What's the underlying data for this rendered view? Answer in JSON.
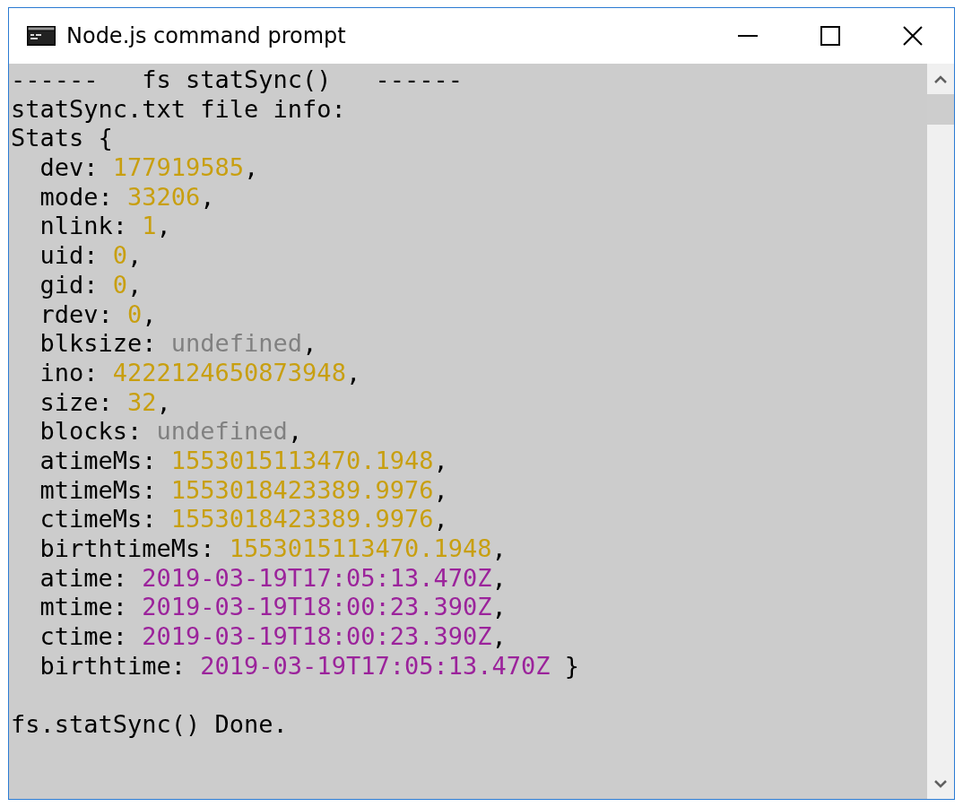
{
  "window": {
    "title": "Node.js command prompt"
  },
  "console": {
    "lines": [
      {
        "kind": "text",
        "segments": [
          {
            "kind": "plain",
            "text": "------   fs statSync()   ------"
          }
        ]
      },
      {
        "kind": "text",
        "segments": [
          {
            "kind": "plain",
            "text": "statSync.txt file info:"
          }
        ]
      },
      {
        "kind": "text",
        "segments": [
          {
            "kind": "plain",
            "text": "Stats {"
          }
        ]
      },
      {
        "kind": "text",
        "segments": [
          {
            "kind": "plain",
            "text": "  dev: "
          },
          {
            "kind": "number",
            "text": "177919585"
          },
          {
            "kind": "plain",
            "text": ","
          }
        ]
      },
      {
        "kind": "text",
        "segments": [
          {
            "kind": "plain",
            "text": "  mode: "
          },
          {
            "kind": "number",
            "text": "33206"
          },
          {
            "kind": "plain",
            "text": ","
          }
        ]
      },
      {
        "kind": "text",
        "segments": [
          {
            "kind": "plain",
            "text": "  nlink: "
          },
          {
            "kind": "number",
            "text": "1"
          },
          {
            "kind": "plain",
            "text": ","
          }
        ]
      },
      {
        "kind": "text",
        "segments": [
          {
            "kind": "plain",
            "text": "  uid: "
          },
          {
            "kind": "number",
            "text": "0"
          },
          {
            "kind": "plain",
            "text": ","
          }
        ]
      },
      {
        "kind": "text",
        "segments": [
          {
            "kind": "plain",
            "text": "  gid: "
          },
          {
            "kind": "number",
            "text": "0"
          },
          {
            "kind": "plain",
            "text": ","
          }
        ]
      },
      {
        "kind": "text",
        "segments": [
          {
            "kind": "plain",
            "text": "  rdev: "
          },
          {
            "kind": "number",
            "text": "0"
          },
          {
            "kind": "plain",
            "text": ","
          }
        ]
      },
      {
        "kind": "text",
        "segments": [
          {
            "kind": "plain",
            "text": "  blksize: "
          },
          {
            "kind": "undefined",
            "text": "undefined"
          },
          {
            "kind": "plain",
            "text": ","
          }
        ]
      },
      {
        "kind": "text",
        "segments": [
          {
            "kind": "plain",
            "text": "  ino: "
          },
          {
            "kind": "number",
            "text": "4222124650873948"
          },
          {
            "kind": "plain",
            "text": ","
          }
        ]
      },
      {
        "kind": "text",
        "segments": [
          {
            "kind": "plain",
            "text": "  size: "
          },
          {
            "kind": "number",
            "text": "32"
          },
          {
            "kind": "plain",
            "text": ","
          }
        ]
      },
      {
        "kind": "text",
        "segments": [
          {
            "kind": "plain",
            "text": "  blocks: "
          },
          {
            "kind": "undefined",
            "text": "undefined"
          },
          {
            "kind": "plain",
            "text": ","
          }
        ]
      },
      {
        "kind": "text",
        "segments": [
          {
            "kind": "plain",
            "text": "  atimeMs: "
          },
          {
            "kind": "number",
            "text": "1553015113470.1948"
          },
          {
            "kind": "plain",
            "text": ","
          }
        ]
      },
      {
        "kind": "text",
        "segments": [
          {
            "kind": "plain",
            "text": "  mtimeMs: "
          },
          {
            "kind": "number",
            "text": "1553018423389.9976"
          },
          {
            "kind": "plain",
            "text": ","
          }
        ]
      },
      {
        "kind": "text",
        "segments": [
          {
            "kind": "plain",
            "text": "  ctimeMs: "
          },
          {
            "kind": "number",
            "text": "1553018423389.9976"
          },
          {
            "kind": "plain",
            "text": ","
          }
        ]
      },
      {
        "kind": "text",
        "segments": [
          {
            "kind": "plain",
            "text": "  birthtimeMs: "
          },
          {
            "kind": "number",
            "text": "1553015113470.1948"
          },
          {
            "kind": "plain",
            "text": ","
          }
        ]
      },
      {
        "kind": "text",
        "segments": [
          {
            "kind": "plain",
            "text": "  atime: "
          },
          {
            "kind": "date",
            "text": "2019-03-19T17:05:13.470Z"
          },
          {
            "kind": "plain",
            "text": ","
          }
        ]
      },
      {
        "kind": "text",
        "segments": [
          {
            "kind": "plain",
            "text": "  mtime: "
          },
          {
            "kind": "date",
            "text": "2019-03-19T18:00:23.390Z"
          },
          {
            "kind": "plain",
            "text": ","
          }
        ]
      },
      {
        "kind": "text",
        "segments": [
          {
            "kind": "plain",
            "text": "  ctime: "
          },
          {
            "kind": "date",
            "text": "2019-03-19T18:00:23.390Z"
          },
          {
            "kind": "plain",
            "text": ","
          }
        ]
      },
      {
        "kind": "text",
        "segments": [
          {
            "kind": "plain",
            "text": "  birthtime: "
          },
          {
            "kind": "date",
            "text": "2019-03-19T17:05:13.470Z"
          },
          {
            "kind": "plain",
            "text": " }"
          }
        ]
      },
      {
        "kind": "blank"
      },
      {
        "kind": "text",
        "segments": [
          {
            "kind": "plain",
            "text": "fs.statSync() Done."
          }
        ]
      }
    ]
  }
}
